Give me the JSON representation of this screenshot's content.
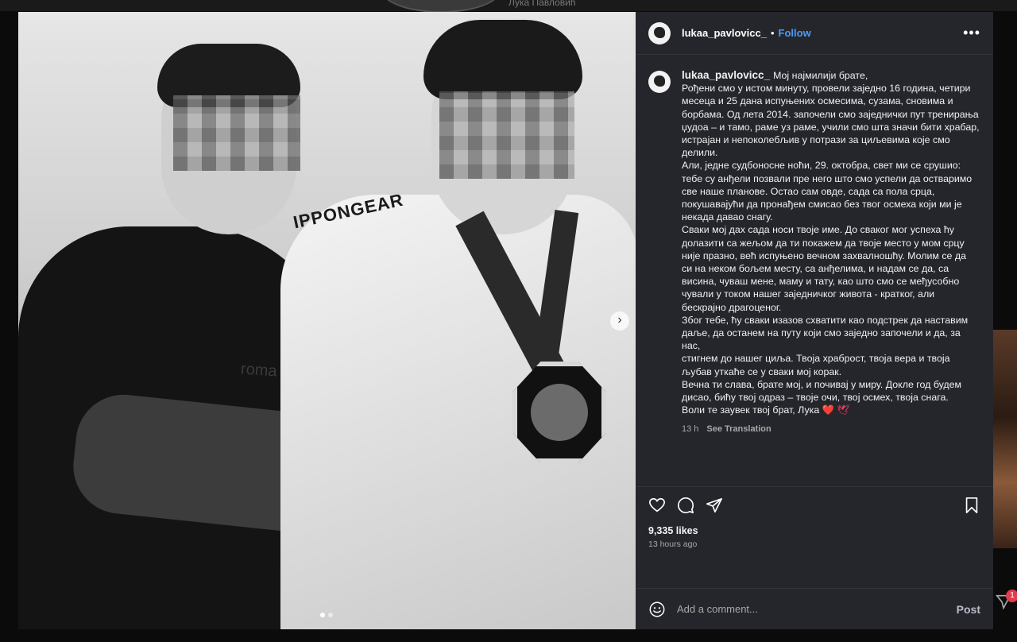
{
  "background": {
    "profile_name": "Лука Павловић",
    "notification_count": "1"
  },
  "post": {
    "username": "lukaa_pavlovicc_",
    "separator": "•",
    "follow_label": "Follow",
    "more_label": "•••",
    "photo_texts": {
      "brand": "IPPONGEAR",
      "hoodie": "roma"
    },
    "carousel": {
      "count": 2,
      "active": 0
    },
    "caption": {
      "first_line": "Мој најмилији брате,",
      "lines": [
        "Рођени смо у истом минуту, провели заједно 16 година, четири",
        "месеца и 25 дана испуњених осмесима, сузама, сновима и",
        "борбама. Од лета 2014. започели смо заједнички пут тренирања",
        "џудоа – и тамо, раме уз раме, учили смо шта значи бити храбар,",
        "истрајан и непоколебљив у потрази за циљевима које смо",
        "делили.",
        "Али, једне судбоносне ноћи, 29. октобра, свет ми се срушио:",
        "тебе су анђели позвали пре него што смо успели да остваримо",
        "све наше планове. Остао сам овде, сада са пола срца,",
        "покушавајући да пронађем смисао без твог осмеха који ми је",
        "некада давао снагу.",
        "Сваки мој дах сада носи твоје име. До сваког мог успеха ћу",
        "долазити са жељом да ти покажем да твоје место у мом срцу",
        "није празно, већ испуњено вечном захвалношћу. Молим се да",
        "си на неком бољем месту, са анђелима, и надам се да, са",
        "висина, чуваш мене, маму и тату, као што смо се међусобно",
        "чували у током нашег заједничког живота - кратког, али",
        "бескрајно драгоценог.",
        "Због тебе, ћу сваки изазов схватити као подстрек да наставим",
        "даље, да останем на путу који смо заједно започели и да, за нас,",
        "стигнем до нашег циља. Твоја храброст, твоја вера и твоја",
        "љубав уткаће се у сваки мој корак.",
        "Вечна ти слава, брате мој, и почивај у миру. Докле год будем",
        "дисао, бићу твој одраз – твоје очи, твој осмех, твоја снага."
      ],
      "last_line": "Воли те заувек твој брат, Лука",
      "last_line_emoji": "❤️ 🕊",
      "time": "13 h",
      "see_translation": "See Translation"
    },
    "likes": "9,335 likes",
    "time_ago": "13 hours ago",
    "comment": {
      "placeholder": "Add a comment...",
      "post_label": "Post"
    },
    "icons": [
      "heart-icon",
      "comment-icon",
      "share-icon",
      "bookmark-icon",
      "emoji-icon",
      "chevron-right-icon",
      "more-icon"
    ]
  }
}
